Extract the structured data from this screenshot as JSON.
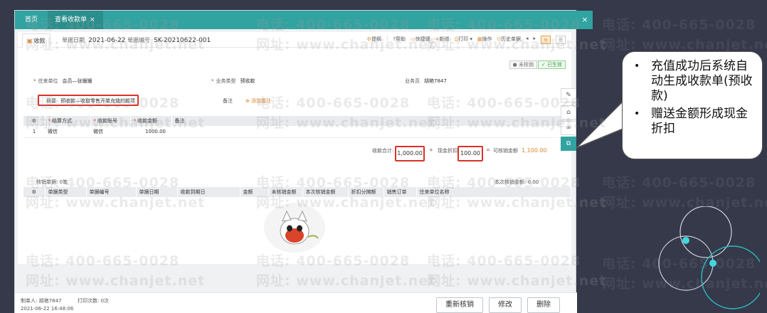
{
  "watermark": {
    "phone": "电话: 400-665-0028",
    "site": "网址: www.chanjet.net"
  },
  "tabs": {
    "home": "首页",
    "active": "查看收款单"
  },
  "form": {
    "tab_label": "收款",
    "date_label": "单据日期",
    "date_value": "2021-06-22",
    "no_label": "单据编号",
    "no_value": "SK-20210622-001",
    "tools": [
      "提纲",
      "帮助",
      "快捷键",
      "新增",
      "打印",
      "操作",
      "历史单据"
    ],
    "status_unverified": "未核销",
    "status_effective": "已生效",
    "partner_label": "往来单位",
    "partner_value": "会员—张姗姗",
    "biz_type_label": "业务类型",
    "biz_type_value": "预收款",
    "clerk_label": "业务员",
    "clerk_value": "胡艳7847",
    "summary_label": "摘要",
    "summary_value": "预收款—收取零售开单充值的款项",
    "remark_label": "备注",
    "add_remark": "添加备注"
  },
  "pay_table": {
    "headers": [
      "结算方式",
      "收款账号",
      "收款金额",
      "备注"
    ],
    "rows": [
      {
        "no": "1",
        "method": "微信",
        "account": "微信",
        "amount": "1000.00",
        "remark": ""
      }
    ]
  },
  "totals": {
    "total_label": "收款合计:",
    "total_value": "1,000.00",
    "plus": "+",
    "discount_label": "现金折扣:",
    "discount_value": "100.00",
    "eq": "=",
    "avail_label": "可核销金额",
    "avail_value": "1,100.00"
  },
  "verify": {
    "count_label": "核销单据: 0笔",
    "amount_label": "本次核销金额: 0.00",
    "headers": [
      "单据类型",
      "单据编号",
      "单据日期",
      "收款到期日",
      "金额",
      "未核销金额",
      "本次核销金额",
      "折扣分摊额",
      "销售订单",
      "往来单位名称"
    ]
  },
  "footer": {
    "maker": "制单人: 胡艳7847",
    "print_count": "打印次数: 0次",
    "time": "2021-06-22 16:48:06",
    "btn_reverify": "重新核销",
    "btn_edit": "修改",
    "btn_delete": "删除"
  },
  "callout": {
    "items": [
      "充值成功后系统自动生成收款单(预收款)",
      "赠送金额形成现金折扣"
    ]
  },
  "colors": {
    "teal": "#31a3a0",
    "highlight": "#d9322b",
    "orange": "#e0862e"
  }
}
